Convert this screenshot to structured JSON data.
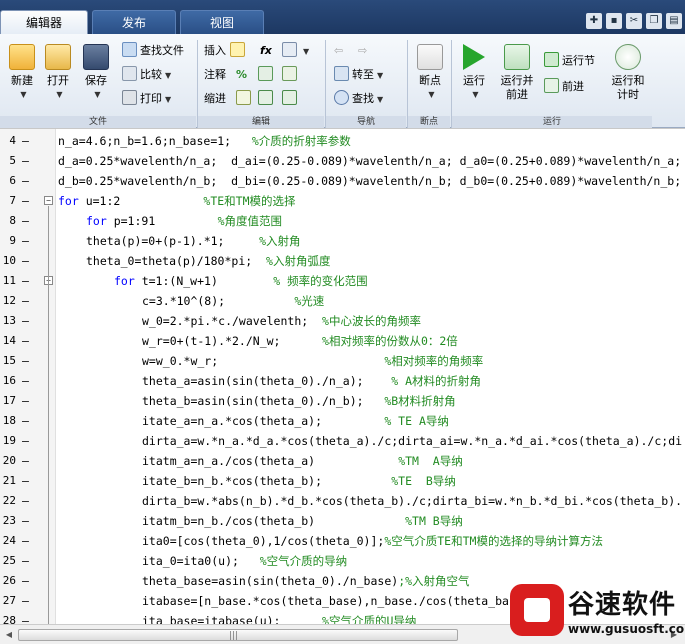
{
  "tabs": [
    {
      "label": "编辑器",
      "active": true
    },
    {
      "label": "发布",
      "active": false
    },
    {
      "label": "视图",
      "active": false
    }
  ],
  "ribbon": {
    "file": {
      "new": "新建",
      "open": "打开",
      "save": "保存",
      "find_files": "查找文件",
      "compare": "比较",
      "print": "打印",
      "group": "文件"
    },
    "edit": {
      "insert": "插入",
      "comment": "注释",
      "indent": "缩进",
      "fx": "fx",
      "percent": "%",
      "group": "编辑"
    },
    "navigate": {
      "goto": "转至",
      "find": "查找",
      "group": "导航"
    },
    "breakpoints": {
      "label": "断点",
      "group": "断点"
    },
    "run": {
      "run": "运行",
      "run_advance": "运行并\n前进",
      "run_section": "运行节",
      "advance": "前进",
      "run_time": "运行和\n计时",
      "group": "运行"
    }
  },
  "code_lines": [
    {
      "n": "4",
      "indent": 0,
      "fold": "",
      "code": [
        [
          "t",
          "n_a=4.6;n_b=1.6;n_base=1;   "
        ],
        [
          "c",
          "%介质的折射率参数"
        ]
      ]
    },
    {
      "n": "5",
      "indent": 0,
      "fold": "",
      "code": [
        [
          "t",
          "d_a=0.25*wavelenth/n_a;  d_ai=(0.25-0.089)*wavelenth/n_a; d_a0=(0.25+0.089)*wavelenth/n_a;"
        ]
      ]
    },
    {
      "n": "6",
      "indent": 0,
      "fold": "",
      "code": [
        [
          "t",
          "d_b=0.25*wavelenth/n_b;  d_bi=(0.25-0.089)*wavelenth/n_b; d_b0=(0.25+0.089)*wavelenth/n_b;"
        ]
      ]
    },
    {
      "n": "7",
      "indent": 0,
      "fold": "open",
      "code": [
        [
          "k",
          "for"
        ],
        [
          "t",
          " u=1:2            "
        ],
        [
          "c",
          "%TE和TM模的选择"
        ]
      ]
    },
    {
      "n": "8",
      "indent": 1,
      "fold": "",
      "code": [
        [
          "k",
          "for"
        ],
        [
          "t",
          " p=1:91         "
        ],
        [
          "c",
          "%角度值范围"
        ]
      ]
    },
    {
      "n": "9",
      "indent": 1,
      "fold": "",
      "code": [
        [
          "t",
          "theta(p)=0+(p-1).*1;     "
        ],
        [
          "c",
          "%入射角"
        ]
      ]
    },
    {
      "n": "10",
      "indent": 1,
      "fold": "",
      "code": [
        [
          "t",
          "theta_0=theta(p)/180*pi;  "
        ],
        [
          "c",
          "%入射角弧度"
        ]
      ]
    },
    {
      "n": "11",
      "indent": 2,
      "fold": "open",
      "code": [
        [
          "k",
          "for"
        ],
        [
          "t",
          " t=1:(N_w+1)        "
        ],
        [
          "c",
          "% 频率的变化范围"
        ]
      ]
    },
    {
      "n": "12",
      "indent": 3,
      "fold": "",
      "code": [
        [
          "t",
          "c=3.*10^(8);          "
        ],
        [
          "c",
          "%光速"
        ]
      ]
    },
    {
      "n": "13",
      "indent": 3,
      "fold": "",
      "code": [
        [
          "t",
          "w_0=2.*pi.*c./wavelenth;  "
        ],
        [
          "c",
          "%中心波长的角频率"
        ]
      ]
    },
    {
      "n": "14",
      "indent": 3,
      "fold": "",
      "code": [
        [
          "t",
          "w_r=0+(t-1).*2./N_w;      "
        ],
        [
          "c",
          "%相对频率的份数从0：2倍"
        ]
      ]
    },
    {
      "n": "15",
      "indent": 3,
      "fold": "",
      "code": [
        [
          "t",
          "w=w_0.*w_r;                        "
        ],
        [
          "c",
          "%相对频率的角频率"
        ]
      ]
    },
    {
      "n": "16",
      "indent": 3,
      "fold": "",
      "code": [
        [
          "t",
          "theta_a=asin(sin(theta_0)./n_a);    "
        ],
        [
          "c",
          "% A材料的折射角"
        ]
      ]
    },
    {
      "n": "17",
      "indent": 3,
      "fold": "",
      "code": [
        [
          "t",
          "theta_b=asin(sin(theta_0)./n_b);   "
        ],
        [
          "c",
          "%B材料折射角"
        ]
      ]
    },
    {
      "n": "18",
      "indent": 3,
      "fold": "",
      "code": [
        [
          "t",
          "itate_a=n_a.*cos(theta_a);         "
        ],
        [
          "c",
          "% TE A导纳"
        ]
      ]
    },
    {
      "n": "19",
      "indent": 3,
      "fold": "",
      "code": [
        [
          "t",
          "dirta_a=w.*n_a.*d_a.*cos(theta_a)./c;dirta_ai=w.*n_a.*d_ai.*cos(theta_a)./c;di"
        ]
      ]
    },
    {
      "n": "20",
      "indent": 3,
      "fold": "",
      "code": [
        [
          "t",
          "itatm_a=n_a./cos(theta_a)            "
        ],
        [
          "c",
          "%TM  A导纳"
        ]
      ]
    },
    {
      "n": "21",
      "indent": 3,
      "fold": "",
      "code": [
        [
          "t",
          "itate_b=n_b.*cos(theta_b);          "
        ],
        [
          "c",
          "%TE  B导纳"
        ]
      ]
    },
    {
      "n": "22",
      "indent": 3,
      "fold": "",
      "code": [
        [
          "t",
          "dirta_b=w.*abs(n_b).*d_b.*cos(theta_b)./c;dirta_bi=w.*n_b.*d_bi.*cos(theta_b)."
        ]
      ]
    },
    {
      "n": "23",
      "indent": 3,
      "fold": "",
      "code": [
        [
          "t",
          "itatm_b=n_b./cos(theta_b)             "
        ],
        [
          "c",
          "%TM B导纳"
        ]
      ]
    },
    {
      "n": "24",
      "indent": 3,
      "fold": "",
      "code": [
        [
          "t",
          "ita0=[cos(theta_0),1/cos(theta_0)];"
        ],
        [
          "c",
          "%空气介质TE和TM模的选择的导纳计算方法"
        ]
      ]
    },
    {
      "n": "25",
      "indent": 3,
      "fold": "",
      "code": [
        [
          "t",
          "ita_0=ita0(u);   "
        ],
        [
          "c",
          "%空气介质的导纳"
        ]
      ]
    },
    {
      "n": "26",
      "indent": 3,
      "fold": "",
      "code": [
        [
          "t",
          "theta_base=asin(sin(theta_0)./n_base)"
        ],
        [
          "c",
          ";%入射角空气"
        ]
      ]
    },
    {
      "n": "27",
      "indent": 3,
      "fold": "",
      "code": [
        [
          "t",
          "itabase=[n_base.*cos(theta_base),n_base./cos(theta_base)];"
        ]
      ]
    },
    {
      "n": "28",
      "indent": 3,
      "fold": "",
      "code": [
        [
          "t",
          "ita_base=itabase(u);      "
        ],
        [
          "c",
          "%空气介质的U导纳"
        ]
      ]
    }
  ],
  "watermark": {
    "title": "谷速软件",
    "url": "www.gusuosft.com"
  },
  "colors": {
    "keyword": "#0000ff",
    "comment": "#228b22",
    "tab_bar": "#1d3862"
  }
}
